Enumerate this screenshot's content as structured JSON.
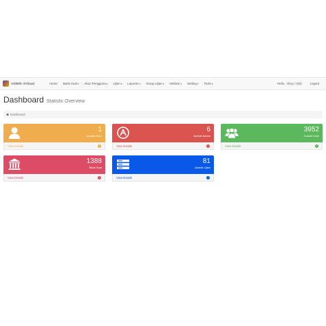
{
  "navbar": {
    "brand": "ADMIN Jirikaal",
    "items": [
      {
        "label": "Home",
        "caret": false
      },
      {
        "label": "Bank Soal",
        "caret": true
      },
      {
        "label": "Akun Pengguna",
        "caret": true
      },
      {
        "label": "Ujian",
        "caret": true
      },
      {
        "label": "Laporan",
        "caret": true
      },
      {
        "label": "Group Ujian",
        "caret": true
      },
      {
        "label": "Institusi",
        "caret": true
      },
      {
        "label": "Setting",
        "caret": true
      },
      {
        "label": "Tools",
        "caret": true
      }
    ],
    "hello": "Hello,",
    "username": "Mnyo Yaldi",
    "logout": "Logout"
  },
  "page": {
    "title": "Dashboard",
    "subtitle": "Statistic Overview"
  },
  "breadcrumb": {
    "label": "Dashboard"
  },
  "panels": [
    {
      "value": "1",
      "caption": "Jumlah Guru",
      "link": "View Details",
      "icon": "user-icon",
      "color": "#f0ad4e"
    },
    {
      "value": "6",
      "caption": "Jumlah Admin",
      "link": "View Details",
      "icon": "admin-icon",
      "color": "#d9534f"
    },
    {
      "value": "3952",
      "caption": "Jumlah User",
      "link": "View Details",
      "icon": "users-group-icon",
      "color": "#5cb85c"
    },
    {
      "value": "1388",
      "caption": "Bank Soal",
      "link": "View Details",
      "icon": "bank-icon",
      "color": "#dc4c64"
    },
    {
      "value": "81",
      "caption": "Jumlah Ujian",
      "link": "View Details",
      "icon": "server-icon",
      "color": "#0a58e8"
    }
  ]
}
